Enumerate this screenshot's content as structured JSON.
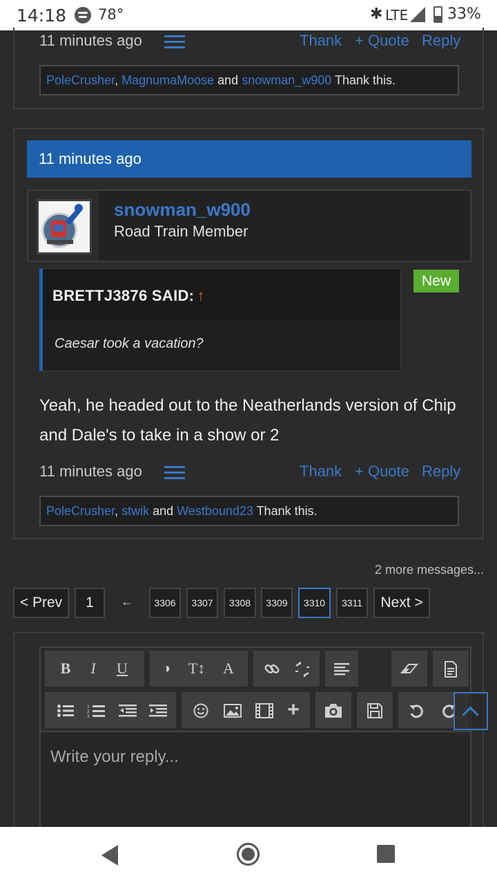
{
  "status_bar": {
    "time": "14:18",
    "temperature": "78°",
    "network": "LTE",
    "battery": "33%"
  },
  "post1": {
    "time": "11 minutes ago",
    "actions": {
      "thank": "Thank",
      "quote": "+ Quote",
      "reply": "Reply"
    },
    "thanks": {
      "users": [
        "PoleCrusher",
        "MagnumaMoose",
        "snowman_w900"
      ],
      "sep1": ", ",
      "sep2": " and ",
      "suffix": " Thank this."
    }
  },
  "post2": {
    "header_time": "11 minutes ago",
    "user": {
      "name": "snowman_w900",
      "title": "Road Train Member"
    },
    "badge": "New",
    "quote": {
      "author": "BRETTJ3876 SAID:",
      "arrow": "↑",
      "text": "Caesar took a vacation?"
    },
    "body": "Yeah, he headed out to the Neatherlands version of Chip and Dale's to take in a show or 2",
    "time": "11 minutes ago",
    "actions": {
      "thank": "Thank",
      "quote": "+ Quote",
      "reply": "Reply"
    },
    "thanks": {
      "users": [
        "PoleCrusher",
        "stwik",
        "Westbound23"
      ],
      "sep1": ", ",
      "sep2": " and ",
      "suffix": " Thank this."
    }
  },
  "pagination": {
    "more_messages": "2 more messages...",
    "prev": "< Prev",
    "first": "1",
    "ellipsis_arrow": "←",
    "pages": [
      "3306",
      "3307",
      "3308",
      "3309",
      "3310",
      "3311"
    ],
    "current": "3310",
    "next": "Next >"
  },
  "editor": {
    "placeholder": "Write your reply...",
    "toolbar_row1": [
      "bold-icon",
      "italic-icon",
      "underline-icon",
      "font-color-icon",
      "font-size-icon",
      "font-family-icon",
      "link-icon",
      "unlink-icon",
      "align-icon",
      "eraser-icon",
      "template-icon"
    ],
    "toolbar_row2": [
      "bullet-list-icon",
      "numbered-list-icon",
      "outdent-icon",
      "indent-icon",
      "smiley-icon",
      "image-icon",
      "media-icon",
      "insert-icon",
      "camera-icon",
      "save-icon",
      "undo-icon",
      "redo-icon"
    ]
  },
  "colors": {
    "accent": "#1e62ae",
    "link": "#3a78c9",
    "new_badge": "#5aad2f",
    "background": "#2b2b2b"
  }
}
